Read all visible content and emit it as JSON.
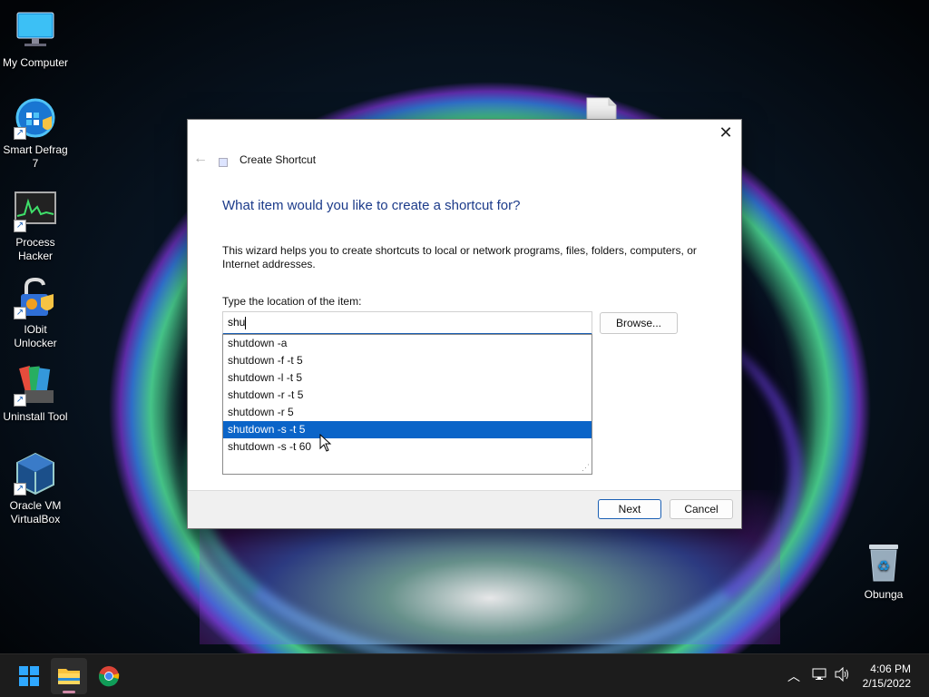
{
  "desktop": {
    "icons": [
      {
        "label": "My Computer"
      },
      {
        "label": "Smart Defrag\n7"
      },
      {
        "label": "Process\nHacker"
      },
      {
        "label": "IObit\nUnlocker"
      },
      {
        "label": "Uninstall Tool"
      },
      {
        "label": "Oracle VM\nVirtualBox"
      },
      {
        "label": "Obunga"
      }
    ]
  },
  "dialog": {
    "window_title": "Create Shortcut",
    "heading": "What item would you like to create a shortcut for?",
    "description": "This wizard helps you to create shortcuts to local or network programs, files, folders, computers, or Internet addresses.",
    "location_label": "Type the location of the item:",
    "location_value": "shu",
    "browse_label": "Browse...",
    "suggestions": [
      "shutdown -a",
      "shutdown -f -t 5",
      "shutdown -l -t 5",
      "shutdown -r -t 5",
      "shutdown -r 5",
      "shutdown -s -t 5",
      "shutdown -s -t 60"
    ],
    "selected_suggestion": "shutdown -s -t 5",
    "next_label": "Next",
    "cancel_label": "Cancel"
  },
  "taskbar": {
    "apps": [
      "start-icon",
      "file-explorer-icon",
      "chrome-icon"
    ],
    "tray_icons": [
      "chevron-up-icon",
      "network-icon",
      "volume-icon"
    ],
    "time": "4:06 PM",
    "date": "2/15/2022"
  },
  "colors": {
    "accent": "#0a64c8",
    "heading": "#1c3b8a",
    "taskbar": "#1c1c1c"
  }
}
